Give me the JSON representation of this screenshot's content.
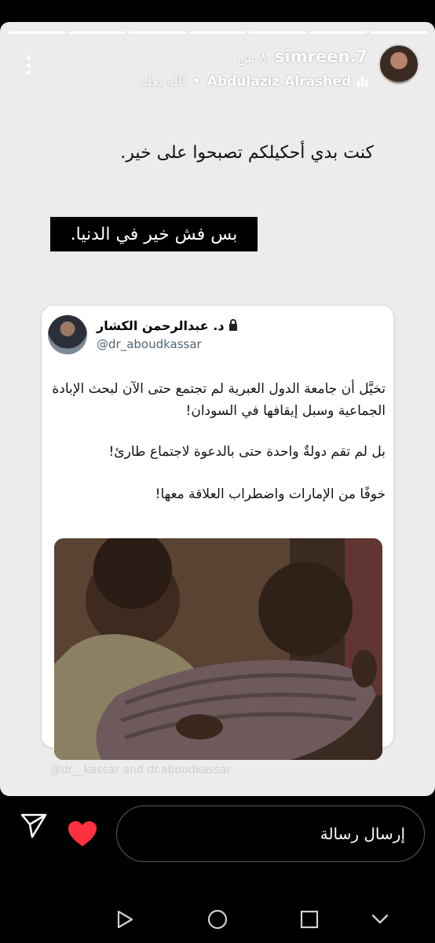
{
  "story": {
    "progress_segments": 7,
    "username": "simreen.7",
    "time": "٨ س",
    "music": {
      "artist": "Abdulaziz Alrashed",
      "song": "الله يعلم"
    },
    "caption_line1": "كنت بدي أحكيلكم تصبحوا على خير.",
    "caption_line2": "بس فش خير في الدنيا."
  },
  "tweet": {
    "author_name": "د. عبدالرحمن الكشار",
    "handle": "@dr_aboudkassar",
    "paragraphs": [
      "تخيَّل أن جامعة الدول العبرية لم تجتمع حتى الآن لبحث الإبادة الجماعية وسبل إيقافها في السودان!",
      "بل لم تقم دولةٌ واحدة حتى بالدعوة لاجتماع طارئ!",
      "خوفًا من الإمارات واضطراب العلاقة معها!"
    ]
  },
  "watermark": "@dr__kassar and dr.aboudkassar",
  "reply": {
    "placeholder": "إرسال رسالة"
  },
  "colors": {
    "heart": "#ff3040",
    "story_bg": "#ececec",
    "tweet_text": "#0f1419",
    "handle": "#536471"
  }
}
